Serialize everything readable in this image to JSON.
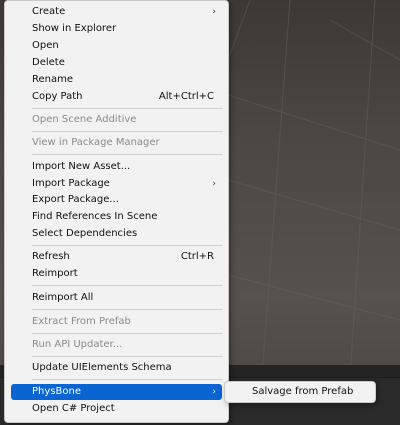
{
  "context_menu": {
    "items": [
      {
        "label": "Create",
        "has_submenu": true
      },
      {
        "label": "Show in Explorer"
      },
      {
        "label": "Open"
      },
      {
        "label": "Delete"
      },
      {
        "label": "Rename"
      },
      {
        "label": "Copy Path",
        "shortcut": "Alt+Ctrl+C"
      },
      {
        "label": "Open Scene Additive",
        "disabled": true
      },
      {
        "label": "View in Package Manager",
        "disabled": true
      },
      {
        "label": "Import New Asset..."
      },
      {
        "label": "Import Package",
        "has_submenu": true
      },
      {
        "label": "Export Package..."
      },
      {
        "label": "Find References In Scene"
      },
      {
        "label": "Select Dependencies"
      },
      {
        "label": "Refresh",
        "shortcut": "Ctrl+R"
      },
      {
        "label": "Reimport"
      },
      {
        "label": "Reimport All"
      },
      {
        "label": "Extract From Prefab",
        "disabled": true
      },
      {
        "label": "Run API Updater...",
        "disabled": true
      },
      {
        "label": "Update UIElements Schema"
      },
      {
        "label": "PhysBone",
        "has_submenu": true,
        "highlighted": true
      },
      {
        "label": "Open C# Project"
      }
    ]
  },
  "submenu": {
    "items": [
      {
        "label": "Salvage from Prefab"
      }
    ]
  },
  "colors": {
    "menu_bg": "#f2f2f2",
    "highlight": "#0a64d2",
    "disabled_text": "#8a8a8a"
  }
}
